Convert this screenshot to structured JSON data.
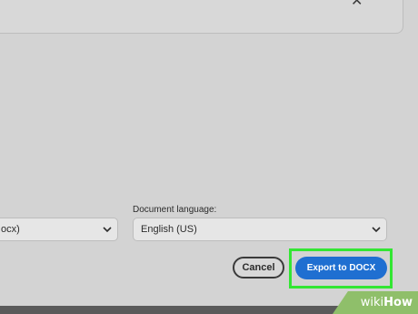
{
  "dialog": {
    "close_glyph": "✕"
  },
  "fields": {
    "format_value": "ocx)",
    "language_label": "Document language:",
    "language_value": "English (US)"
  },
  "actions": {
    "cancel_label": "Cancel",
    "export_label": "Export to DOCX"
  },
  "watermark": {
    "wiki": "wiki",
    "how": "How"
  },
  "colors": {
    "background": "#d3d3d3",
    "primary_button": "#1f6fd1",
    "highlight": "#33e633",
    "watermark": "#8fbf6a"
  }
}
